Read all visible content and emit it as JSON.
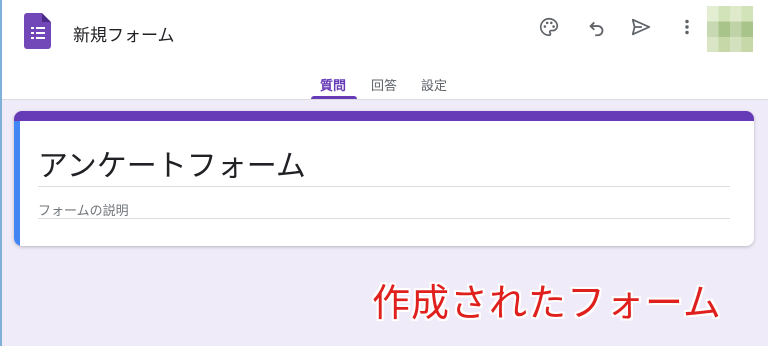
{
  "header": {
    "document_title": "新規フォーム",
    "icons": [
      "palette-icon",
      "undo-icon",
      "send-icon",
      "more-vert-icon"
    ],
    "accent_color": "#673ab7"
  },
  "tabs": [
    {
      "label": "質問",
      "active": true
    },
    {
      "label": "回答",
      "active": false
    },
    {
      "label": "設定",
      "active": false
    }
  ],
  "form": {
    "title": "アンケートフォーム",
    "description_placeholder": "フォームの説明"
  },
  "annotation": "作成されたフォーム"
}
